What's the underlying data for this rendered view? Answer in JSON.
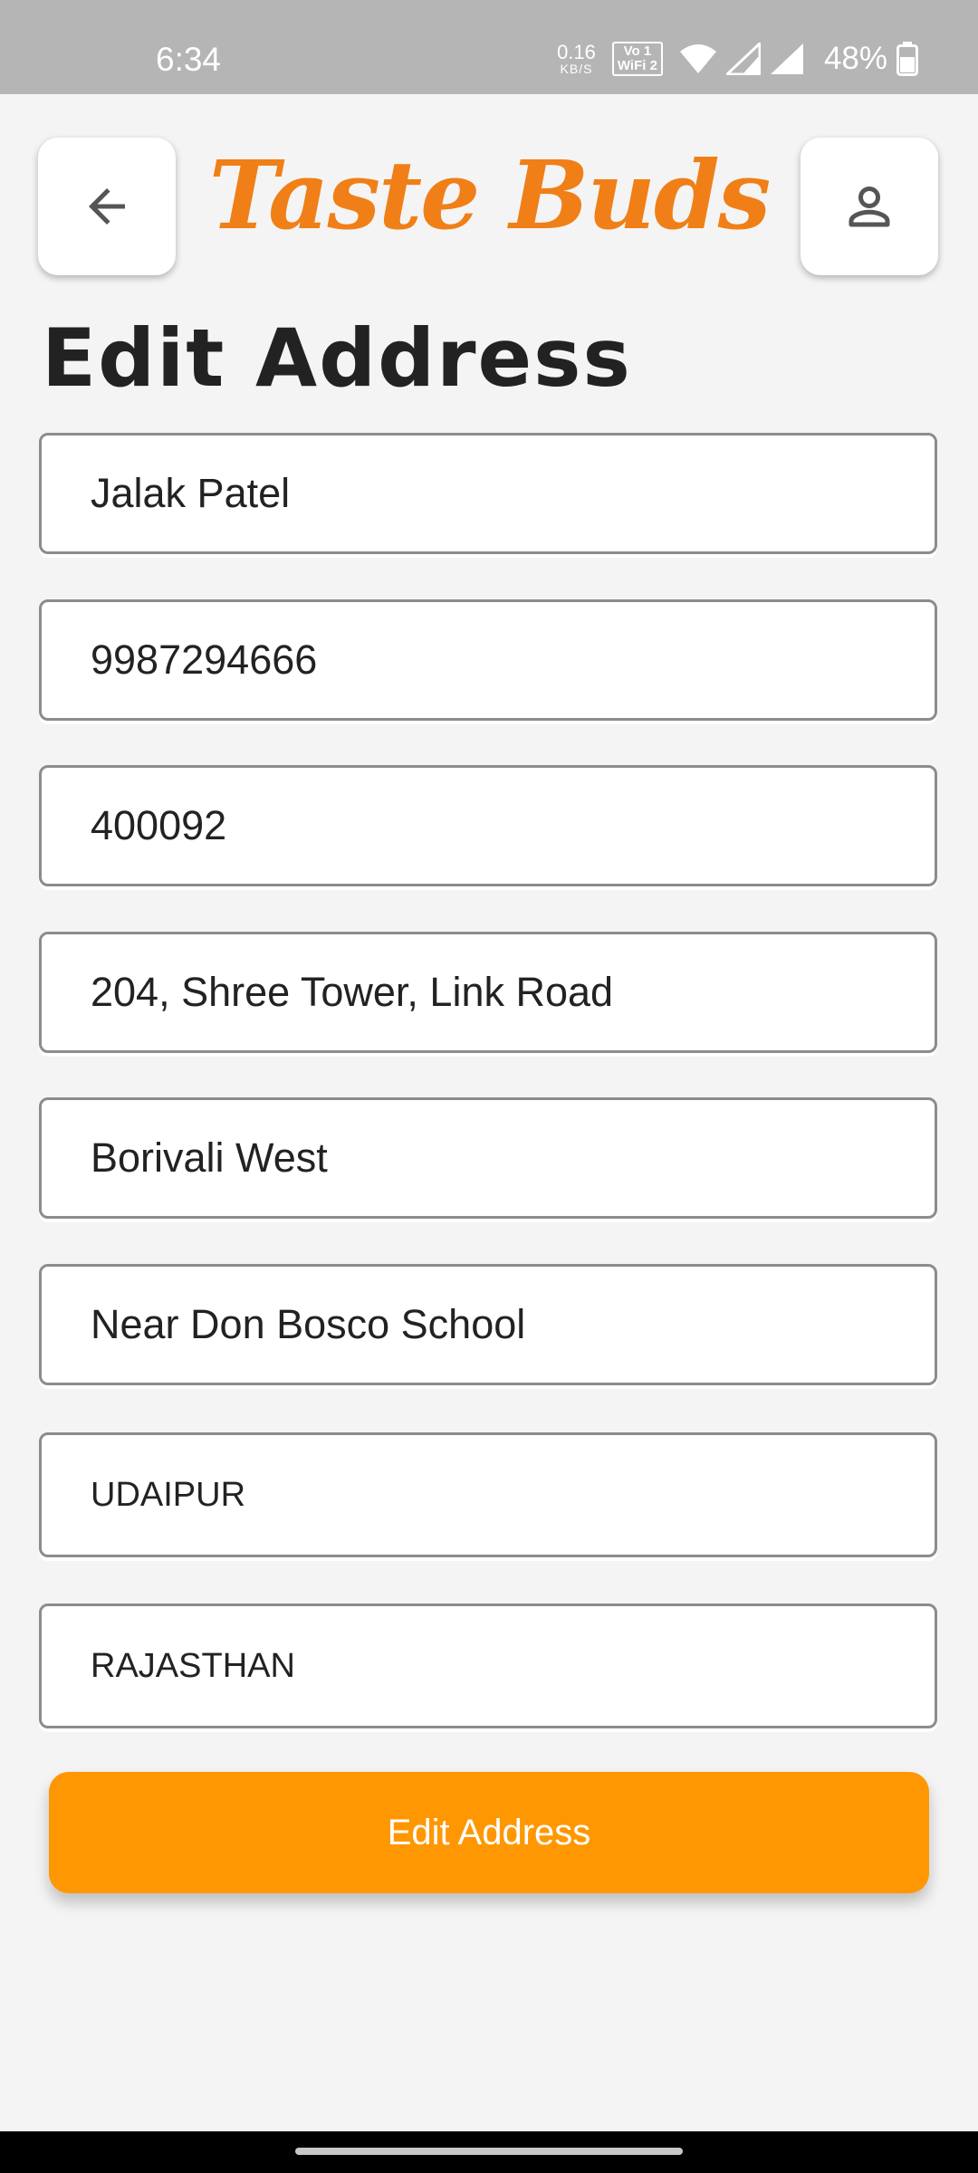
{
  "status_bar": {
    "time": "6:34",
    "net_speed_value": "0.16",
    "net_speed_unit": "KB/S",
    "volte_line1": "Vo 1",
    "volte_line2": "WiFi 2",
    "battery_percent": "48%",
    "icons": [
      "wifi-icon",
      "signal-icon",
      "signal-icon",
      "battery-icon"
    ]
  },
  "header": {
    "brand": "Taste Buds",
    "back_icon": "arrow-left-icon",
    "profile_icon": "person-icon",
    "brand_color": "#f07f17"
  },
  "page": {
    "title": "Edit Address"
  },
  "form": {
    "fields": [
      {
        "value": "Jalak Patel"
      },
      {
        "value": "9987294666"
      },
      {
        "value": "400092"
      },
      {
        "value": "204, Shree Tower, Link Road"
      },
      {
        "value": "Borivali West"
      },
      {
        "value": "Near Don Bosco School"
      },
      {
        "value": "UDAIPUR"
      },
      {
        "value": "RAJASTHAN"
      }
    ],
    "submit_label": "Edit Address",
    "submit_color": "#ff9702"
  }
}
